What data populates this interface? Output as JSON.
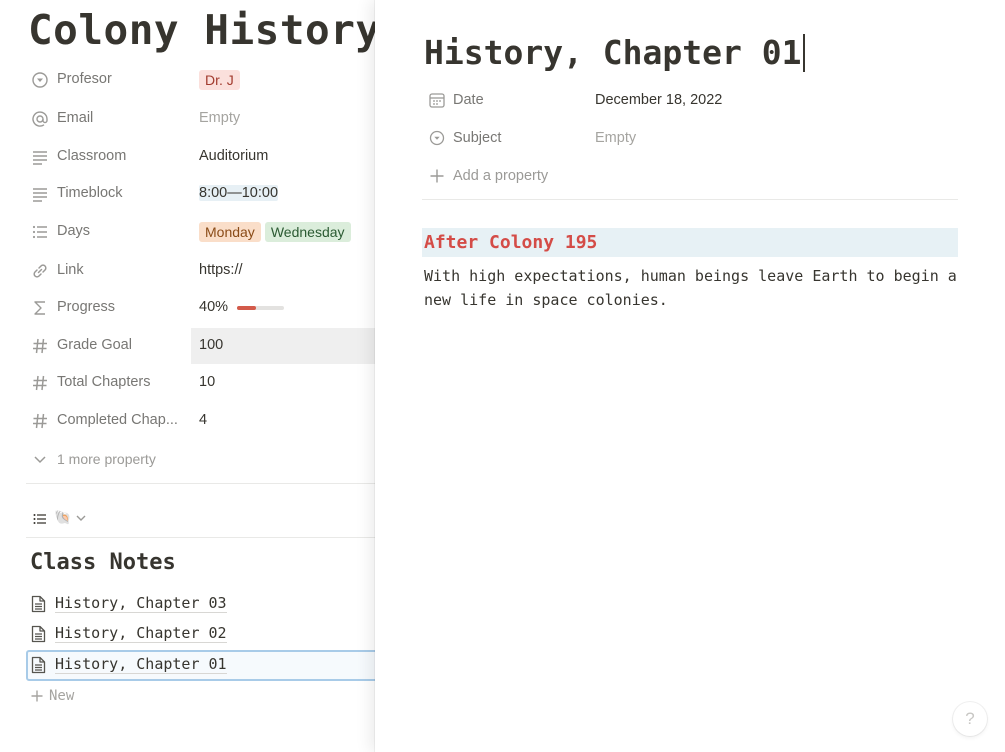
{
  "page": {
    "title": "Colony History",
    "properties": [
      {
        "icon": "select-icon",
        "name": "Profesor",
        "value": "Dr. J",
        "kind": "tag",
        "color": "#fbe0dc"
      },
      {
        "icon": "at-sign-icon",
        "name": "Email",
        "value": "Empty",
        "kind": "empty"
      },
      {
        "icon": "text-lines-icon",
        "name": "Classroom",
        "value": "Auditorium",
        "kind": "text"
      },
      {
        "icon": "text-lines-icon",
        "name": "Timeblock",
        "value": "8:00—10:00",
        "kind": "highlight"
      },
      {
        "icon": "list-icon",
        "name": "Days",
        "value": [
          "Monday",
          "Wednesday"
        ],
        "kind": "multi-tag"
      },
      {
        "icon": "link-icon",
        "name": "Link",
        "value": "https://",
        "kind": "text"
      },
      {
        "icon": "sigma-icon",
        "name": "Progress",
        "value": "40%",
        "kind": "progress",
        "fraction": 0.4,
        "bar_color": "#d35a4a"
      },
      {
        "icon": "hash-icon",
        "name": "Grade Goal",
        "value": "100",
        "kind": "number"
      },
      {
        "icon": "hash-icon",
        "name": "Total Chapters",
        "value": "10",
        "kind": "number"
      },
      {
        "icon": "hash-icon",
        "name": "Completed Chap...",
        "value": "4",
        "kind": "number"
      }
    ],
    "more_properties": "1 more property",
    "view_icon": "🐚",
    "class_notes": {
      "title": "Class Notes",
      "items": [
        "History, Chapter 03",
        "History, Chapter 02",
        "History, Chapter 01"
      ],
      "selected_index": 2,
      "new_label": "New"
    }
  },
  "peek": {
    "title": "History, Chapter 01",
    "properties": [
      {
        "icon": "calendar-icon",
        "name": "Date",
        "value": "December 18, 2022"
      },
      {
        "icon": "select-icon",
        "name": "Subject",
        "value": "Empty"
      }
    ],
    "add_property": "Add a property",
    "callout": "After Colony 195",
    "callout_color": "#d44c47",
    "body": "With high expectations, human beings leave Earth to begin a new life in space colonies.",
    "help": "?"
  }
}
